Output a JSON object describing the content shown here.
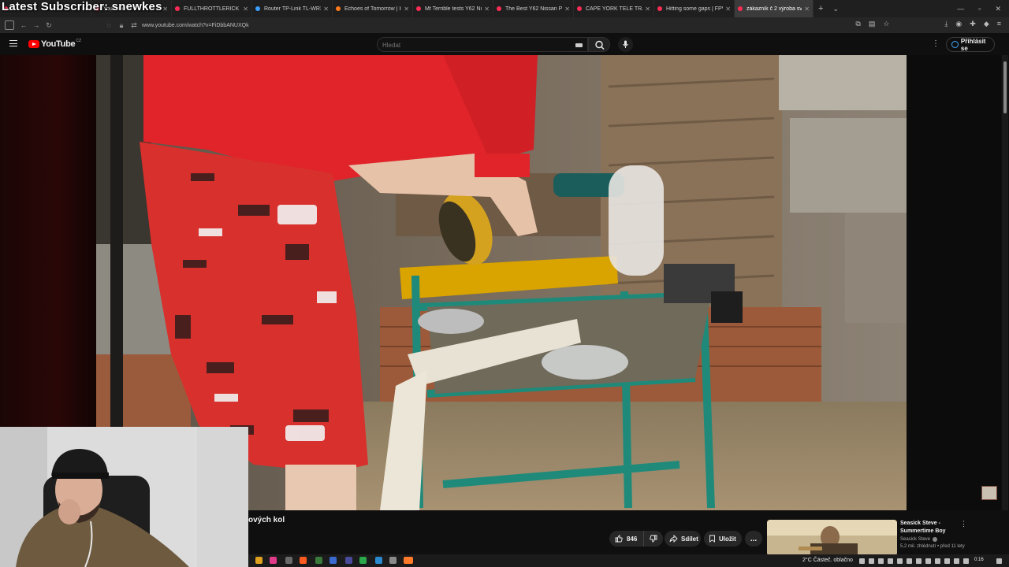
{
  "overlay": {
    "stream_text": "Latest Subscriber: snewkes"
  },
  "browser": {
    "tabs": [
      {
        "label": "",
        "favicon": "youtube"
      },
      {
        "label": "YouTube",
        "favicon": "youtube"
      },
      {
        "label": "FULLTHROTTLERICK - YouTu",
        "favicon": "youtube"
      },
      {
        "label": "Router TP-Link TL-WR3002",
        "favicon": "link"
      },
      {
        "label": "Echoes of Tomorrow | Insta",
        "favicon": "instagram"
      },
      {
        "label": "Mt Terrible tests Y62 Nissan",
        "favicon": "youtube"
      },
      {
        "label": "The Best Y62 Nissan Patrol",
        "favicon": "youtube"
      },
      {
        "label": "CAPE YORK TELE TRACK LAS",
        "favicon": "youtube"
      },
      {
        "label": "Hitting some gaps | FPV Fre",
        "favicon": "youtube"
      },
      {
        "label": "zákazník č 2 výroba svo",
        "favicon": "youtube",
        "active": true
      }
    ],
    "url": "www.youtube.com/watch?v=FiDbbANUXQk"
  },
  "youtube": {
    "logo_text": "YouTube",
    "country_code": "CZ",
    "search_placeholder": "Hledat",
    "signin_label": "Přihlásit se",
    "video_title": "ových kol",
    "like_count": "846",
    "share_label": "Sdílet",
    "save_label": "Uložit",
    "more_label": "...",
    "recommendation": {
      "title": "Seasick Steve - Summertime Boy",
      "channel": "Seasick Steve",
      "meta": "5,2 mil. zhlédnutí • před 11 lety"
    }
  },
  "taskbar": {
    "weather": "2°C  Částeč. oblačno",
    "time": "0:16"
  },
  "colors": {
    "accent_red": "#ff0000",
    "link_blue": "#3ea6ff",
    "bg": "#0f0f0f",
    "pill": "#272727"
  }
}
